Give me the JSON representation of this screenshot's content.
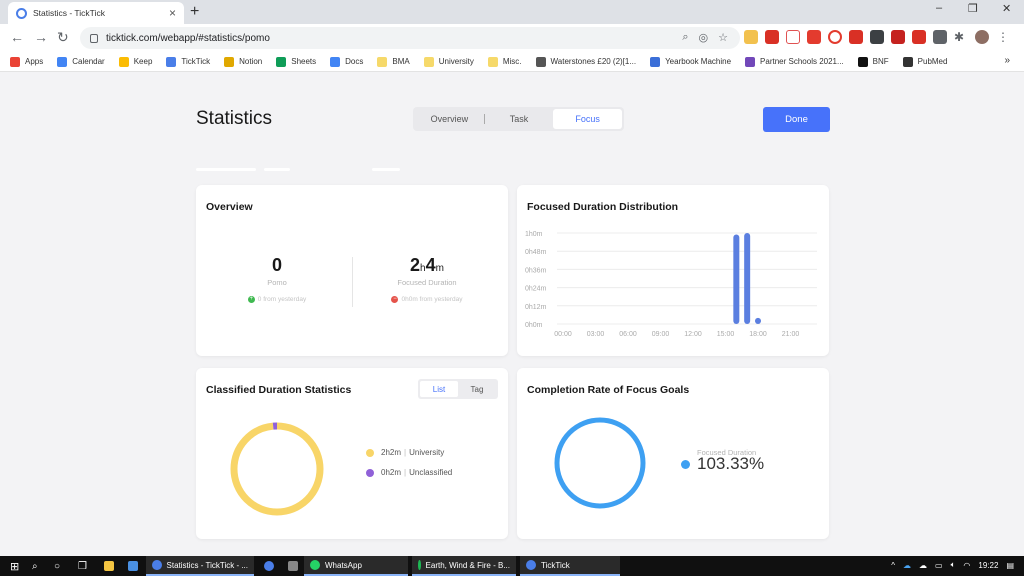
{
  "browser": {
    "tab_title": "Statistics - TickTick",
    "url": "ticktick.com/webapp/#statistics/pomo",
    "win_minimize": "–",
    "win_restore": "❐",
    "win_close": "✕",
    "bookmarks": [
      {
        "label": "Apps",
        "color": "#ea4335"
      },
      {
        "label": "Calendar",
        "color": "#4285f4"
      },
      {
        "label": "Keep",
        "color": "#fbbc04"
      },
      {
        "label": "TickTick",
        "color": "#4a7ee8"
      },
      {
        "label": "Notion",
        "color": "#e0a800"
      },
      {
        "label": "Sheets",
        "color": "#0f9d58"
      },
      {
        "label": "Docs",
        "color": "#4285f4"
      },
      {
        "label": "BMA",
        "color": "#f6d96a"
      },
      {
        "label": "University",
        "color": "#f6d96a"
      },
      {
        "label": "Misc.",
        "color": "#f6d96a"
      },
      {
        "label": "Waterstones £20 (2)[1...",
        "color": "#555555"
      },
      {
        "label": "Yearbook Machine",
        "color": "#3b6fd8"
      },
      {
        "label": "Partner Schools 2021...",
        "color": "#7248b9"
      },
      {
        "label": "BNF",
        "color": "#111111"
      },
      {
        "label": "PubMed",
        "color": "#333333"
      }
    ],
    "more": "»"
  },
  "header": {
    "title": "Statistics",
    "tabs": [
      "Overview",
      "Task",
      "Focus"
    ],
    "active_tab": "Focus",
    "done_label": "Done"
  },
  "overview": {
    "title": "Overview",
    "pomo_value": "0",
    "pomo_label": "Pomo",
    "pomo_change": "0 from yesterday",
    "duration_h": "2",
    "duration_h_unit": "h",
    "duration_m": "4",
    "duration_m_unit": "m",
    "duration_label": "Focused Duration",
    "duration_change": "0h0m from yesterday"
  },
  "distribution": {
    "title": "Focused Duration Distribution"
  },
  "chart_data": {
    "type": "bar",
    "title": "Focused Duration Distribution",
    "xlabel": "",
    "ylabel": "",
    "x_ticks": [
      "00:00",
      "03:00",
      "06:00",
      "09:00",
      "12:00",
      "15:00",
      "18:00",
      "21:00"
    ],
    "y_ticks": [
      "0h0m",
      "0h12m",
      "0h24m",
      "0h36m",
      "0h48m",
      "1h0m"
    ],
    "ylim": [
      0,
      60
    ],
    "xlim": [
      0,
      24
    ],
    "categories": [
      "16:00",
      "17:00",
      "18:00"
    ],
    "hours": [
      16,
      17,
      18
    ],
    "values": [
      59,
      60,
      4
    ],
    "color": "#5b7fe0",
    "grid": true
  },
  "classified": {
    "title": "Classified Duration Statistics",
    "toggle": [
      "List",
      "Tag"
    ],
    "active_toggle": "List",
    "items": [
      {
        "duration": "2h2m",
        "name": "University",
        "minutes": 122,
        "color": "#f8d568"
      },
      {
        "duration": "0h2m",
        "name": "Unclassified",
        "minutes": 2,
        "color": "#9061d8"
      }
    ]
  },
  "completion": {
    "title": "Completion Rate of Focus Goals",
    "label": "Focused Duration",
    "value": "103.33%",
    "color": "#3ea0f2"
  },
  "taskbar": {
    "items": [
      {
        "label": "Statistics - TickTick - ...",
        "color": "#4a7ee8"
      },
      {
        "label": "WhatsApp",
        "color": "#25d366"
      },
      {
        "label": "Earth, Wind & Fire - B...",
        "color": "#1db954"
      },
      {
        "label": "TickTick",
        "color": "#4a7ee8"
      }
    ],
    "time": "19:22"
  }
}
